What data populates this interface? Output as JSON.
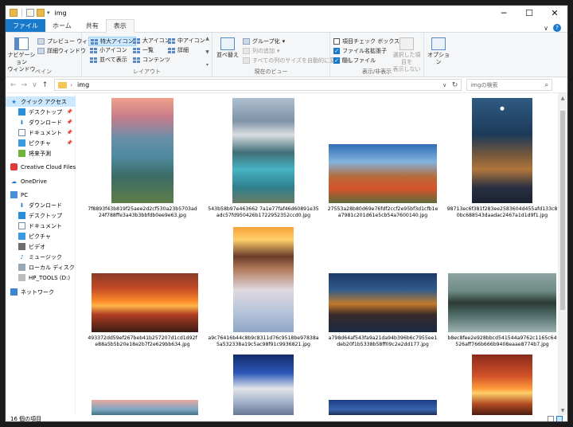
{
  "window": {
    "title": "img"
  },
  "titlebar": {
    "minimize": "─",
    "maximize": "☐",
    "close": "✕"
  },
  "tabs": [
    {
      "label": "ファイル"
    },
    {
      "label": "ホーム"
    },
    {
      "label": "共有"
    },
    {
      "label": "表示"
    }
  ],
  "ribbon": {
    "pane": {
      "nav_pane_label": "ナビゲーション\nウィンドウ",
      "preview_label": "プレビュー ウィンドウ",
      "details_pane_label": "詳細ウィンドウ",
      "group_label": "ペイン"
    },
    "layout": {
      "extra_large": "特大アイコン",
      "large": "大アイコン",
      "medium": "中アイコン",
      "small": "小アイコン",
      "list": "一覧",
      "details": "詳細",
      "tiles": "並べて表示",
      "content": "コンテンツ",
      "group_label": "レイアウト"
    },
    "current_view": {
      "sort_label": "並べ替え",
      "group_by": "グループ化",
      "add_column": "列の追加",
      "size_all_columns": "すべての列のサイズを自動的に変更する",
      "group_label": "現在のビュー"
    },
    "show_hide": {
      "item_checkboxes": "項目チェック ボックス",
      "file_extensions": "ファイル名拡張子",
      "hidden_items": "隠しファイル",
      "hide_selected": "選択した項目を\n表示しない",
      "group_label": "表示/非表示"
    },
    "options_label": "オプション"
  },
  "address": {
    "path_folder": "img",
    "search_placeholder": "imgの検索"
  },
  "sidebar": {
    "items": [
      {
        "label": "クイック アクセス",
        "icon": "star-icon",
        "pinned": false
      },
      {
        "label": "デスクトップ",
        "icon": "desktop-icon",
        "pinned": true
      },
      {
        "label": "ダウンロード",
        "icon": "download-icon",
        "pinned": true
      },
      {
        "label": "ドキュメント",
        "icon": "document-icon",
        "pinned": true
      },
      {
        "label": "ピクチャ",
        "icon": "pictures-icon",
        "pinned": true
      },
      {
        "label": "将来予測",
        "icon": "folder-icon",
        "pinned": false
      },
      {
        "label": "Creative Cloud Files",
        "icon": "creative-cloud-icon",
        "pinned": false
      },
      {
        "label": "OneDrive",
        "icon": "onedrive-icon",
        "pinned": false
      },
      {
        "label": "PC",
        "icon": "pc-icon",
        "pinned": false
      },
      {
        "label": "ダウンロード",
        "icon": "download-icon",
        "pinned": false
      },
      {
        "label": "デスクトップ",
        "icon": "desktop-icon",
        "pinned": false
      },
      {
        "label": "ドキュメント",
        "icon": "document-icon",
        "pinned": false
      },
      {
        "label": "ピクチャ",
        "icon": "pictures-icon",
        "pinned": false
      },
      {
        "label": "ビデオ",
        "icon": "video-icon",
        "pinned": false
      },
      {
        "label": "ミュージック",
        "icon": "music-icon",
        "pinned": false
      },
      {
        "label": "ローカル ディスク (C:)",
        "icon": "disk-icon",
        "pinned": false
      },
      {
        "label": "HP_TOOLS (D:)",
        "icon": "disk-icon",
        "pinned": false
      },
      {
        "label": "ネットワーク",
        "icon": "network-icon",
        "pinned": false
      }
    ]
  },
  "files": [
    {
      "name": "7f8893f43b819f25aee2d2cf530a23b5703ad24f788ffe3a43b3bbfdb0ee9e63.jpg"
    },
    {
      "name": "543b58b97e463662 7a1e77faf46d60891e35adc57fd950426b1722952352ccd0.jpg"
    },
    {
      "name": "27553a28b80d69e76fdf2ccf2e95bf3d1cfb1ea7981c201d61e5cb54a7600140.jpg"
    },
    {
      "name": "98713ec6f381f283ee2583604d455afd133c80bc688543daadac2467a1d1d9f1.jpg"
    },
    {
      "name": "493372dd59ef267beb41b257207d1cd1d92fe88a5b5b20e18e2b7f2e629bb634.jpg"
    },
    {
      "name": "a9c76416b44c8b9c8311d76c9518be97838a5a532338a19c5ac98f91c9936821.jpg"
    },
    {
      "name": "a798d64af543fa9a21da94b396b6c7955ee1deb20f1b5338b58ff09c2e2dd177.jpg"
    },
    {
      "name": "b8ec8fee2e928bbcd541544a9762c1165c64526aff766b666b9408eaae8774b7.jpg"
    }
  ],
  "status": {
    "item_count": "16 個の項目"
  }
}
